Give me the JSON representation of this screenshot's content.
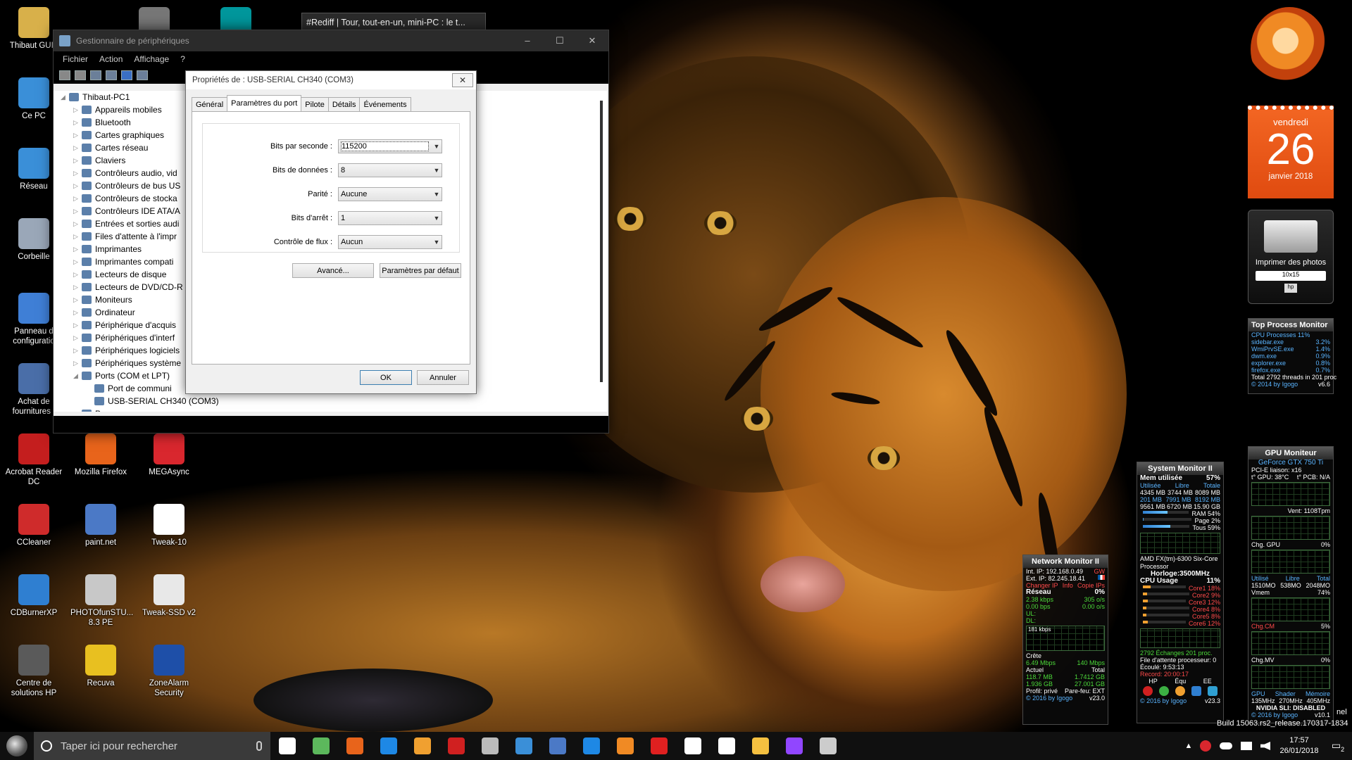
{
  "desktop": {
    "icons": [
      {
        "label": "Thibaut GUIL",
        "icon": "user-folder-icon",
        "color": "#d8b04a"
      },
      {
        "label": "Ce PC",
        "icon": "computer-icon",
        "color": "#3a8fd8"
      },
      {
        "label": "Réseau",
        "icon": "network-icon",
        "color": "#3a8fd8"
      },
      {
        "label": "Corbeille",
        "icon": "recycle-bin-icon",
        "color": "#9aa7b8"
      },
      {
        "label": "Panneau d configuratio",
        "icon": "control-panel-icon",
        "color": "#3f7fd6"
      },
      {
        "label": "Achat de fournitures I",
        "icon": "printer-supplies-icon",
        "color": "#4a6ea8"
      },
      {
        "label": "Acrobat Reader DC",
        "icon": "acrobat-icon",
        "color": "#c41e1e"
      },
      {
        "label": "Mozilla Firefox",
        "icon": "firefox-icon",
        "color": "#e8641b"
      },
      {
        "label": "MEGAsync",
        "icon": "megasync-icon",
        "color": "#d9272e"
      },
      {
        "label": "CCleaner",
        "icon": "ccleaner-icon",
        "color": "#cf2b2b"
      },
      {
        "label": "paint.net",
        "icon": "paintnet-icon",
        "color": "#4b79c6"
      },
      {
        "label": "Tweak-10",
        "icon": "tweak10-icon",
        "color": "#ffffff"
      },
      {
        "label": "CDBurnerXP",
        "icon": "cdburnerxp-icon",
        "color": "#2f7fd1"
      },
      {
        "label": "PHOTOfunSTU... 8.3 PE",
        "icon": "camera-icon",
        "color": "#c8c8c8"
      },
      {
        "label": "Tweak-SSD v2",
        "icon": "tweak-ssd-icon",
        "color": "#e8e8e8"
      },
      {
        "label": "Centre de solutions HP",
        "icon": "hp-icon",
        "color": "#5a5a5a"
      },
      {
        "label": "Recuva",
        "icon": "recuva-icon",
        "color": "#e8c020"
      },
      {
        "label": "ZoneAlarm Security",
        "icon": "zonealarm-icon",
        "color": "#1e4fa8"
      },
      {
        "label": "",
        "icon": "vmware-icon",
        "color": "#777777"
      },
      {
        "label": "",
        "icon": "arduino-icon",
        "color": "#00979c"
      }
    ]
  },
  "browser_tab_tooltip": "#Rediff | Tour, tout-en-un, mini-PC : le t...",
  "device_manager": {
    "title": "Gestionnaire de périphériques",
    "menu": [
      "Fichier",
      "Action",
      "Affichage",
      "?"
    ],
    "window_controls": [
      "–",
      "☐",
      "✕"
    ],
    "tree": [
      {
        "label": "Thibaut-PC1",
        "level": 0,
        "expanded": true
      },
      {
        "label": "Appareils mobiles",
        "level": 1
      },
      {
        "label": "Bluetooth",
        "level": 1
      },
      {
        "label": "Cartes graphiques",
        "level": 1
      },
      {
        "label": "Cartes réseau",
        "level": 1
      },
      {
        "label": "Claviers",
        "level": 1
      },
      {
        "label": "Contrôleurs audio, vid",
        "level": 1
      },
      {
        "label": "Contrôleurs de bus US",
        "level": 1
      },
      {
        "label": "Contrôleurs de stocka",
        "level": 1
      },
      {
        "label": "Contrôleurs IDE ATA/A",
        "level": 1
      },
      {
        "label": "Entrées et sorties audi",
        "level": 1
      },
      {
        "label": "Files d'attente à l'impr",
        "level": 1
      },
      {
        "label": "Imprimantes",
        "level": 1
      },
      {
        "label": "Imprimantes compati",
        "level": 1
      },
      {
        "label": "Lecteurs de disque",
        "level": 1
      },
      {
        "label": "Lecteurs de DVD/CD-R",
        "level": 1
      },
      {
        "label": "Moniteurs",
        "level": 1
      },
      {
        "label": "Ordinateur",
        "level": 1
      },
      {
        "label": "Périphérique d'acquis",
        "level": 1
      },
      {
        "label": "Périphériques d'interf",
        "level": 1
      },
      {
        "label": "Périphériques logiciels",
        "level": 1
      },
      {
        "label": "Périphériques système",
        "level": 1
      },
      {
        "label": "Ports (COM et LPT)",
        "level": 1,
        "expanded": true
      },
      {
        "label": "Port de communi",
        "level": 2
      },
      {
        "label": "USB-SERIAL CH340 (COM3)",
        "level": 2
      },
      {
        "label": "Processeurs",
        "level": 1
      }
    ]
  },
  "properties_dialog": {
    "title": "Propriétés de : USB-SERIAL CH340 (COM3)",
    "close": "✕",
    "tabs": [
      "Général",
      "Paramètres du port",
      "Pilote",
      "Détails",
      "Événements"
    ],
    "active_tab": "Paramètres du port",
    "fields": [
      {
        "label": "Bits par seconde :",
        "value": "115200"
      },
      {
        "label": "Bits de données :",
        "value": "8"
      },
      {
        "label": "Parité :",
        "value": "Aucune"
      },
      {
        "label": "Bits d'arrêt :",
        "value": "1"
      },
      {
        "label": "Contrôle de flux :",
        "value": "Aucun"
      }
    ],
    "advanced_button": "Avancé...",
    "defaults_button": "Paramètres par défaut",
    "ok_button": "OK",
    "cancel_button": "Annuler"
  },
  "calendar_gadget": {
    "weekday": "vendredi",
    "day": "26",
    "month_year": "janvier 2018"
  },
  "printer_gadget": {
    "label": "Imprimer des photos",
    "size": "10x15",
    "brand": "hp"
  },
  "top_process_monitor": {
    "title": "Top Process Monitor",
    "summary": "CPU Processes 11%",
    "processes": [
      {
        "name": "sidebar.exe",
        "value": "3.2%"
      },
      {
        "name": "WmiPrvSE.exe",
        "value": "1.4%"
      },
      {
        "name": "dwm.exe",
        "value": "0.9%"
      },
      {
        "name": "explorer.exe",
        "value": "0.8%"
      },
      {
        "name": "firefox.exe",
        "value": "0.7%"
      }
    ],
    "total": "Total 2792 threads in 201 proc",
    "footer": "© 2014 by Igogo",
    "version": "v6.6"
  },
  "system_monitor": {
    "title": "System Monitor II",
    "mem_label": "Mem utilisée",
    "mem_pct": "57%",
    "mem_headers": [
      "Utilisée",
      "Libre",
      "Totale"
    ],
    "mem_rows": [
      [
        "4345 MB",
        "3744 MB",
        "8089 MB"
      ],
      [
        "201 MB",
        "7991 MB",
        "8192 MB"
      ],
      [
        "9561 MB",
        "6720 MB",
        "15.90 GB"
      ]
    ],
    "mem_bars": [
      {
        "label": "RAM",
        "pct": "54%",
        "level": 0.54
      },
      {
        "label": "Page",
        "pct": "2%",
        "level": 0.02
      },
      {
        "label": "Tous",
        "pct": "59%",
        "level": 0.59
      }
    ],
    "cpu_name": "AMD FX(tm)-6300 Six-Core Processor",
    "clock": "Horloge:3500MHz",
    "cpu_usage_label": "CPU Usage",
    "cpu_usage": "11%",
    "cores": [
      {
        "name": "Core1",
        "pct": "18%",
        "level": 0.18
      },
      {
        "name": "Core2",
        "pct": "9%",
        "level": 0.09
      },
      {
        "name": "Core3",
        "pct": "12%",
        "level": 0.12
      },
      {
        "name": "Core4",
        "pct": "8%",
        "level": 0.08
      },
      {
        "name": "Core5",
        "pct": "8%",
        "level": 0.08
      },
      {
        "name": "Core6",
        "pct": "12%",
        "level": 0.12
      }
    ],
    "exchanges": "2792 Échanges 201 proc.",
    "queue": "File d'attente processeur: 0",
    "elapsed": "Écoulé: 9:53:13",
    "record": "Record: 20:00:17",
    "buttons": [
      "HP",
      "Équ",
      "EE"
    ],
    "footer": "© 2016 by Igogo",
    "version": "v23.3"
  },
  "network_monitor": {
    "title": "Network Monitor II",
    "int_ip": "Int. IP: 192.168.0.49",
    "ext_ip": "Ext. IP: 82.245.18.41",
    "gw": "GW",
    "links": [
      "Changer IP",
      "Info",
      "Copie IPs"
    ],
    "network_label": "Réseau",
    "network_pct": "0%",
    "rates": [
      [
        "2.38 kbps",
        "305 o/s"
      ],
      [
        "0.00 bps",
        "0.00 o/s"
      ]
    ],
    "ul_label": "UL:",
    "dl_label": "DL:",
    "graph_label": "181 kbps",
    "peak_label": "Crête",
    "peak": [
      "6.49 Mbps",
      "140 Mbps"
    ],
    "current_label": "Actuel",
    "total_label": "Total",
    "current": [
      "118.7 MB",
      "1.7412 GB"
    ],
    "total": [
      "1.936 GB",
      "27.001 GB"
    ],
    "profile": "Profil: privé",
    "firewall": "Pare-feu: EXT",
    "footer": "© 2016 by Igogo",
    "version": "v23.0"
  },
  "gpu_monitor": {
    "title": "GPU Moniteur",
    "gpu_name": "GeForce GTX 750 Ti",
    "pcie": "PCI-E liaison: x16",
    "temps": [
      "t° GPU: 38°C",
      "t° PCB: N/A"
    ],
    "vent": "Vent: 1108Tpm",
    "gpu_load": "Chg. GPU",
    "gpu_load_pct": "0%",
    "mem_headers": [
      "Utilisé",
      "Libre",
      "Total"
    ],
    "mem_row": [
      "1510MO",
      "538MO",
      "2048MO"
    ],
    "vmem": "Vmem",
    "vmem_pct": "74%",
    "cm_label": "Chg.CM",
    "cm_pct": "5%",
    "mv_label": "Chg.MV",
    "mv_pct": "0%",
    "clocks_headers": [
      "GPU",
      "Shader",
      "Mémoire"
    ],
    "clocks": [
      "135MHz",
      "270MHz",
      "405MHz"
    ],
    "sli": "NVIDIA SLI: DISABLED",
    "footer": "© 2016 by Igogo",
    "version": "v10.1"
  },
  "watermark": {
    "edition": "nel",
    "build": "Build 15063.rs2_release.170317-1834"
  },
  "taskbar": {
    "search_placeholder": "Taper ici pour rechercher",
    "apps": [
      {
        "icon": "task-view-icon",
        "color": "#ffffff"
      },
      {
        "icon": "clover-icon",
        "color": "#5cb85c"
      },
      {
        "icon": "firefox-taskbar-icon",
        "color": "#e8641b"
      },
      {
        "icon": "edge-icon",
        "color": "#1e88e5"
      },
      {
        "icon": "media-player-icon",
        "color": "#f0a030"
      },
      {
        "icon": "video-app-icon",
        "color": "#d02020"
      },
      {
        "icon": "tools-icon",
        "color": "#bbbbbb"
      },
      {
        "icon": "gear-app-icon",
        "color": "#3a8fd8"
      },
      {
        "icon": "paintnet-taskbar-icon",
        "color": "#4b79c6"
      },
      {
        "icon": "ccleaner-taskbar-icon",
        "color": "#1e88e5"
      },
      {
        "icon": "blender-icon",
        "color": "#f08a24"
      },
      {
        "icon": "pdf-app-icon",
        "color": "#e02020"
      },
      {
        "icon": "store-icon",
        "color": "#ffffff"
      },
      {
        "icon": "mail-icon",
        "color": "#ffffff"
      },
      {
        "icon": "file-explorer-icon",
        "color": "#f5c040"
      },
      {
        "icon": "twitch-icon",
        "color": "#9146ff"
      },
      {
        "icon": "network-app-icon",
        "color": "#cccccc"
      }
    ],
    "time": "17:57",
    "date": "26/01/2018",
    "notifications": "2"
  }
}
